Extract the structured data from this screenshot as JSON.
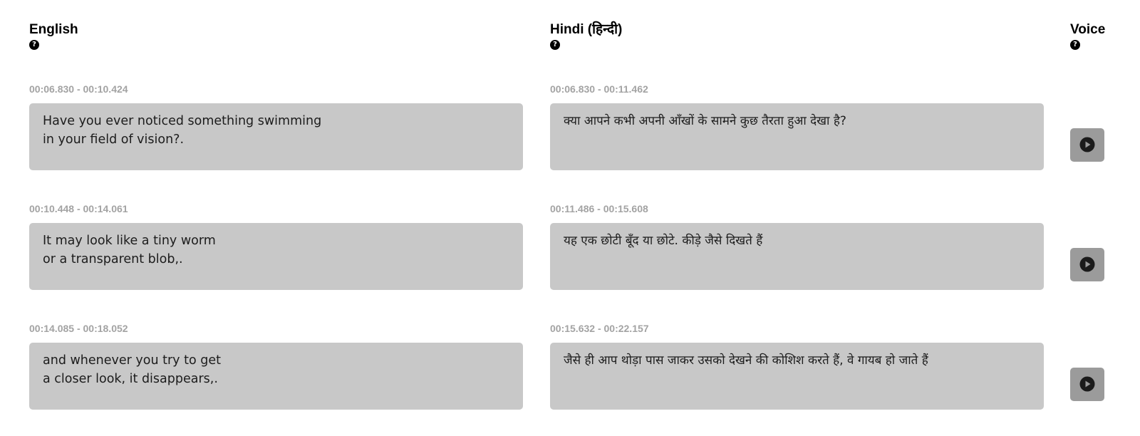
{
  "columns": {
    "english": {
      "title": "English",
      "help_icon": "question-circle-icon"
    },
    "hindi": {
      "title": "Hindi (हिन्दी)",
      "help_icon": "question-circle-icon"
    },
    "voice": {
      "title": "Voice",
      "help_icon": "question-circle-icon"
    }
  },
  "segments": [
    {
      "english_time": "00:06.830 - 00:10.424",
      "english_text": "Have you ever noticed something swimming\nin your field of vision?.",
      "hindi_time": "00:06.830 - 00:11.462",
      "hindi_text": "क्या आपने कभी अपनी आँखों के सामने कुछ तैरता हुआ देखा है?",
      "voice_icon": "play-circle-icon"
    },
    {
      "english_time": "00:10.448 - 00:14.061",
      "english_text": "It may look like a tiny worm\nor a transparent blob,.",
      "hindi_time": "00:11.486 - 00:15.608",
      "hindi_text": "यह एक छोटी बूँद या छोटे. कीड़े जैसे दिखते हैं",
      "voice_icon": "play-circle-icon"
    },
    {
      "english_time": "00:14.085 - 00:18.052",
      "english_text": "and whenever you try to get\na closer look, it disappears,.",
      "hindi_time": "00:15.632 - 00:22.157",
      "hindi_text": "जैसे ही आप थोड़ा पास जाकर उसको देखने की कोशिश करते हैं, वे गायब हो जाते हैं",
      "voice_icon": "play-circle-icon"
    }
  ],
  "colors": {
    "text_box_bg": "#c8c8c8",
    "play_button_bg": "#9b9b9b",
    "timecode": "#a3a3a3"
  }
}
